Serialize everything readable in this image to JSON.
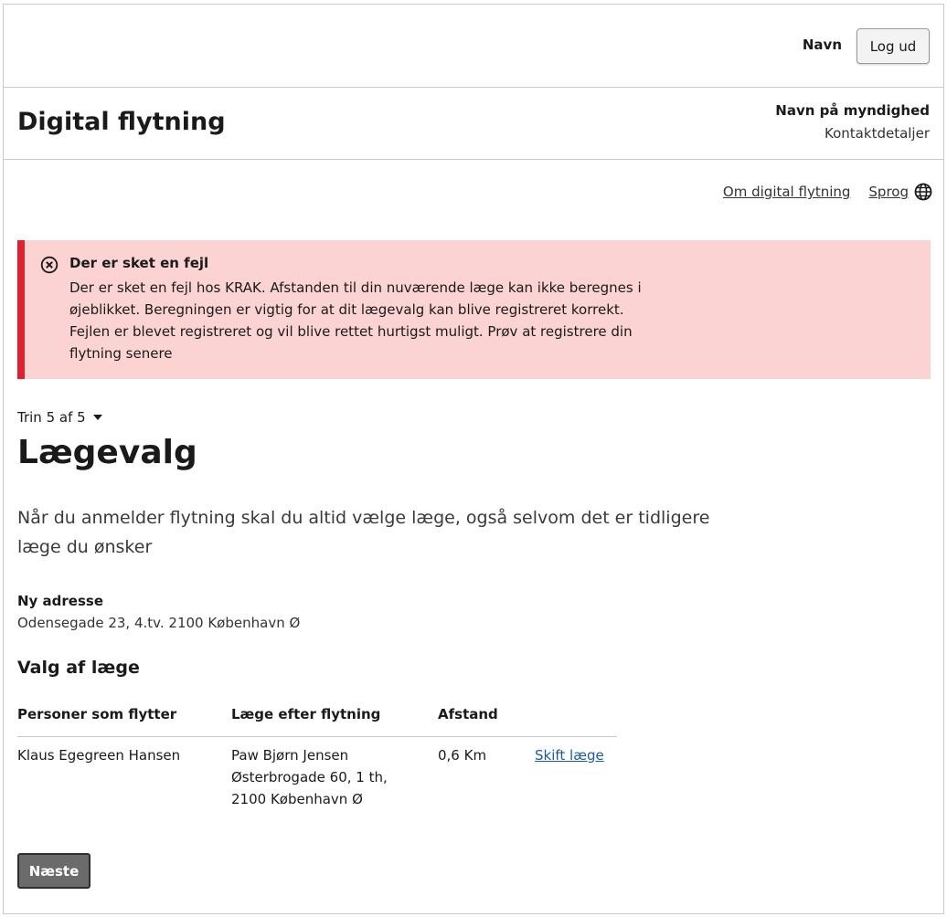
{
  "topbar": {
    "user_name": "Navn",
    "logout_label": "Log ud"
  },
  "header": {
    "title": "Digital flytning",
    "authority_name": "Navn på myndighed",
    "contact_label": "Kontaktdetaljer"
  },
  "utility": {
    "about_label": "Om digital flytning",
    "language_label": "Sprog"
  },
  "alert": {
    "title": "Der er sket en fejl",
    "body": "Der er sket en fejl hos KRAK. Afstanden til din nuværende læge kan ikke beregnes i øjeblikket. Beregningen er vigtig for at dit lægevalg kan blive registreret korrekt. Fejlen er blevet registreret og vil blive rettet hurtigst muligt. Prøv at registrere din flytning senere",
    "color": "#e0202e"
  },
  "step": {
    "label": "Trin 5 af 5"
  },
  "page": {
    "title": "Lægevalg",
    "lead": "Når du anmelder flytning skal du altid vælge læge, også selvom det er tidligere læge du ønsker"
  },
  "address": {
    "label": "Ny adresse",
    "value": "Odensegade 23, 4.tv. 2100 København Ø"
  },
  "doctor_section": {
    "title": "Valg af læge",
    "headers": [
      "Personer som flytter",
      "Læge efter flytning",
      "Afstand",
      ""
    ],
    "rows": [
      {
        "person": "Klaus Egegreen Hansen",
        "doctor_name": "Paw Bjørn Jensen",
        "doctor_street": "Østerbrogade 60, 1 th,",
        "doctor_city": "2100 København Ø",
        "distance": "0,6 Km",
        "change_label": "Skift læge"
      }
    ]
  },
  "actions": {
    "next_label": "Næste"
  }
}
